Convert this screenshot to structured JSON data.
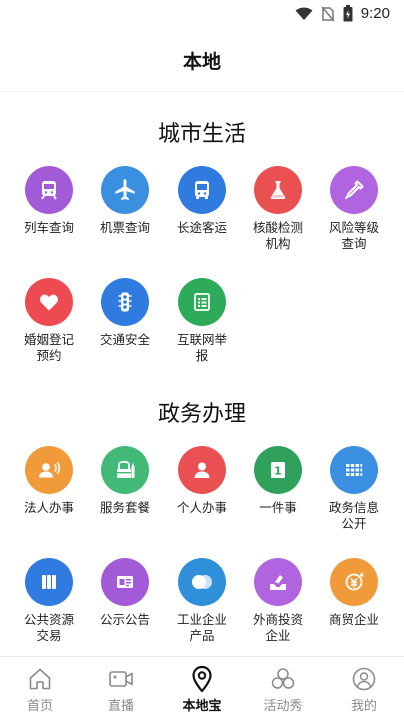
{
  "status_bar": {
    "time": "9:20"
  },
  "header": {
    "title": "本地"
  },
  "sections": [
    {
      "title": "城市生活",
      "items": [
        {
          "label": "列车查询",
          "icon": "train-icon",
          "color": "#a35ad9"
        },
        {
          "label": "机票查询",
          "icon": "airplane-icon",
          "color": "#3b8fe0"
        },
        {
          "label": "长途客运",
          "icon": "bus-icon",
          "color": "#2f7be0"
        },
        {
          "label": "核酸检测\n机构",
          "icon": "flask-icon",
          "color": "#ea5052"
        },
        {
          "label": "风险等级\n查询",
          "icon": "pipette-icon",
          "color": "#b064e0"
        },
        {
          "label": "婚姻登记\n预约",
          "icon": "heart-icon",
          "color": "#ee4a52"
        },
        {
          "label": "交通安全",
          "icon": "traffic-light-icon",
          "color": "#2f7be0"
        },
        {
          "label": "互联网举\n报",
          "icon": "report-icon",
          "color": "#2eaa5b"
        }
      ]
    },
    {
      "title": "政务办理",
      "items": [
        {
          "label": "法人办事",
          "icon": "legal-person-icon",
          "color": "#f19a3a"
        },
        {
          "label": "服务套餐",
          "icon": "service-package-icon",
          "color": "#43b978"
        },
        {
          "label": "个人办事",
          "icon": "person-icon",
          "color": "#ea5052"
        },
        {
          "label": "一件事",
          "icon": "one-matter-icon",
          "color": "#2fa15a"
        },
        {
          "label": "政务信息\n公开",
          "icon": "grid-icon",
          "color": "#3b8fe0"
        },
        {
          "label": "公共资源\n交易",
          "icon": "columns-icon",
          "color": "#2f7be0"
        },
        {
          "label": "公示公告",
          "icon": "notice-icon",
          "color": "#a35ad9"
        },
        {
          "label": "工业企业\n产品",
          "icon": "product-icon",
          "color": "#2f8fd8"
        },
        {
          "label": "外商投资\n企业",
          "icon": "ballot-icon",
          "color": "#b064e0"
        },
        {
          "label": "商贸企业",
          "icon": "trade-icon",
          "color": "#f19a3a"
        }
      ]
    }
  ],
  "tabbar": [
    {
      "label": "首页",
      "icon": "home-icon",
      "active": false
    },
    {
      "label": "直播",
      "icon": "video-icon",
      "active": false
    },
    {
      "label": "本地宝",
      "icon": "location-pin-icon",
      "active": true
    },
    {
      "label": "活动秀",
      "icon": "activity-icon",
      "active": false
    },
    {
      "label": "我的",
      "icon": "profile-icon",
      "active": false
    }
  ]
}
